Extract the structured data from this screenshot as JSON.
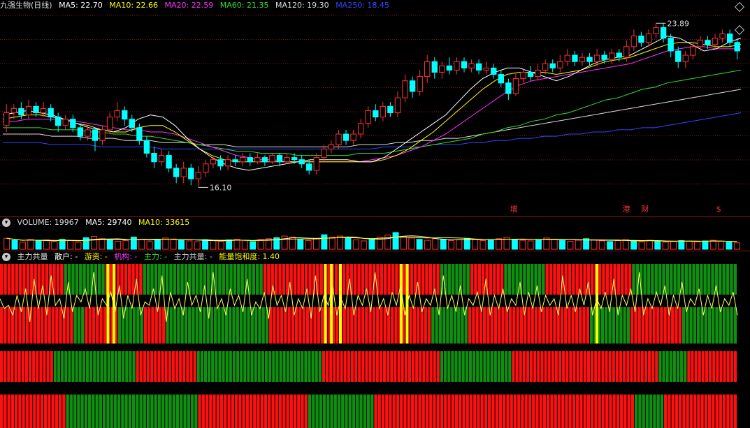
{
  "price_header": {
    "title": "九强生物(日线)",
    "ma": [
      {
        "label": "MA5: 22.70",
        "color": "#ffffff"
      },
      {
        "label": "MA10: 22.66",
        "color": "#ffff00"
      },
      {
        "label": "MA20: 22.59",
        "color": "#ff33ff"
      },
      {
        "label": "MA60: 21.35",
        "color": "#33dd33"
      },
      {
        "label": "MA120: 19.30",
        "color": "#dddddd"
      },
      {
        "label": "MA250: 18.45",
        "color": "#3344ff"
      }
    ]
  },
  "price_annotations": {
    "high": "23.89",
    "low": "16.10"
  },
  "event_marks": [
    "增",
    "港",
    "财",
    "$"
  ],
  "volume_header": {
    "title": "VOLUME: 19967",
    "ma5": "MA5: 29740",
    "ma10": "MA10: 33615"
  },
  "indicator_header": {
    "title": "主力共量",
    "items": [
      {
        "label": "散户: -",
        "color": "#ffffff"
      },
      {
        "label": "游资: -",
        "color": "#ffff00"
      },
      {
        "label": "机构: -",
        "color": "#ff33ff"
      },
      {
        "label": "主力: -",
        "color": "#33dd33"
      },
      {
        "label": "主力共量: -",
        "color": "#cccccc"
      },
      {
        "label": "能量饱和度: 1.40",
        "color": "#ffff00"
      }
    ]
  },
  "colors": {
    "up": "#ff3333",
    "down": "#00ffff",
    "bar_red": "#ff1010",
    "bar_green": "#109010",
    "highlight": "#ffff00",
    "grid": "#8a1212"
  },
  "chart_data": {
    "type": "candlestick",
    "price_axis": {
      "min": 15.2,
      "max": 24.6
    },
    "candles": [
      [
        19.3,
        19.9,
        20.3,
        19.0
      ],
      [
        19.9,
        20.1,
        20.3,
        19.6
      ],
      [
        20.1,
        19.8,
        20.4,
        19.6
      ],
      [
        19.8,
        20.2,
        20.5,
        19.6
      ],
      [
        20.2,
        19.9,
        20.4,
        19.7
      ],
      [
        19.9,
        20.1,
        20.4,
        19.7
      ],
      [
        20.1,
        19.7,
        20.3,
        19.5
      ],
      [
        19.7,
        19.3,
        19.9,
        19.0
      ],
      [
        19.3,
        19.6,
        19.8,
        19.1
      ],
      [
        19.6,
        19.2,
        19.8,
        19.0
      ],
      [
        19.2,
        18.8,
        19.4,
        18.6
      ],
      [
        18.8,
        19.1,
        19.3,
        18.6
      ],
      [
        19.1,
        18.6,
        19.2,
        18.1
      ],
      [
        18.6,
        19.1,
        19.3,
        18.4
      ],
      [
        19.1,
        19.7,
        19.9,
        18.9
      ],
      [
        19.7,
        20.0,
        20.4,
        19.5
      ],
      [
        20.0,
        19.6,
        20.2,
        19.3
      ],
      [
        19.6,
        19.2,
        19.8,
        19.0
      ],
      [
        19.2,
        18.6,
        19.4,
        18.4
      ],
      [
        18.6,
        18.0,
        18.8,
        17.8
      ],
      [
        18.0,
        17.6,
        18.3,
        17.3
      ],
      [
        17.6,
        17.9,
        18.2,
        17.4
      ],
      [
        17.9,
        17.3,
        18.1,
        17.1
      ],
      [
        17.3,
        16.9,
        17.5,
        16.6
      ],
      [
        16.9,
        17.3,
        17.6,
        16.6
      ],
      [
        17.3,
        16.8,
        17.5,
        16.5
      ],
      [
        16.8,
        17.1,
        17.4,
        16.4
      ],
      [
        17.1,
        17.5,
        17.7,
        16.9
      ],
      [
        17.5,
        17.7,
        17.9,
        17.3
      ],
      [
        17.7,
        17.4,
        17.9,
        17.2
      ],
      [
        17.4,
        17.7,
        17.9,
        17.2
      ],
      [
        17.7,
        17.6,
        17.9,
        17.4
      ],
      [
        17.6,
        17.8,
        18.0,
        17.4
      ],
      [
        17.8,
        17.6,
        18.0,
        17.4
      ],
      [
        17.6,
        17.8,
        18.0,
        17.5
      ],
      [
        17.8,
        17.6,
        17.9,
        17.4
      ],
      [
        17.6,
        17.9,
        18.0,
        17.5
      ],
      [
        17.9,
        17.6,
        18.0,
        17.4
      ],
      [
        17.6,
        17.8,
        18.0,
        17.5
      ],
      [
        17.8,
        17.7,
        18.0,
        17.5
      ],
      [
        17.7,
        17.5,
        17.9,
        17.3
      ],
      [
        17.5,
        17.2,
        17.7,
        17.0
      ],
      [
        17.2,
        17.8,
        18.0,
        17.0
      ],
      [
        17.8,
        18.2,
        18.4,
        17.6
      ],
      [
        18.2,
        18.4,
        18.6,
        18.0
      ],
      [
        18.4,
        18.9,
        19.1,
        18.2
      ],
      [
        18.9,
        18.6,
        19.1,
        18.4
      ],
      [
        18.6,
        18.9,
        19.1,
        18.4
      ],
      [
        18.9,
        19.4,
        19.6,
        18.7
      ],
      [
        19.4,
        20.0,
        20.2,
        19.2
      ],
      [
        20.0,
        19.7,
        20.3,
        19.5
      ],
      [
        19.7,
        20.2,
        20.4,
        19.5
      ],
      [
        20.2,
        19.9,
        20.4,
        19.7
      ],
      [
        19.9,
        20.6,
        20.9,
        19.7
      ],
      [
        20.6,
        21.4,
        21.7,
        20.4
      ],
      [
        21.4,
        20.9,
        21.6,
        20.6
      ],
      [
        20.9,
        21.6,
        21.9,
        20.7
      ],
      [
        21.6,
        22.3,
        22.6,
        21.3
      ],
      [
        22.3,
        21.8,
        22.5,
        21.5
      ],
      [
        21.8,
        22.1,
        22.3,
        21.5
      ],
      [
        22.1,
        21.9,
        22.5,
        21.7
      ],
      [
        21.9,
        22.3,
        22.5,
        21.7
      ],
      [
        22.3,
        22.0,
        22.5,
        21.8
      ],
      [
        22.0,
        22.2,
        22.4,
        21.8
      ],
      [
        22.2,
        21.9,
        22.4,
        21.7
      ],
      [
        21.9,
        22.0,
        22.3,
        21.7
      ],
      [
        22.0,
        21.7,
        22.2,
        21.5
      ],
      [
        21.7,
        21.3,
        21.9,
        21.1
      ],
      [
        21.3,
        20.8,
        21.5,
        20.5
      ],
      [
        20.8,
        21.5,
        21.8,
        20.7
      ],
      [
        21.5,
        21.8,
        22.0,
        21.3
      ],
      [
        21.8,
        21.6,
        22.1,
        21.4
      ],
      [
        21.6,
        21.9,
        22.2,
        21.4
      ],
      [
        21.9,
        22.2,
        22.4,
        21.7
      ],
      [
        22.2,
        22.0,
        22.4,
        21.8
      ],
      [
        22.0,
        22.3,
        22.6,
        21.8
      ],
      [
        22.3,
        22.6,
        22.9,
        22.1
      ],
      [
        22.6,
        22.3,
        22.8,
        22.1
      ],
      [
        22.3,
        22.5,
        22.7,
        22.1
      ],
      [
        22.5,
        22.3,
        22.7,
        22.1
      ],
      [
        22.3,
        22.6,
        22.9,
        22.1
      ],
      [
        22.6,
        22.4,
        22.8,
        22.2
      ],
      [
        22.4,
        22.7,
        22.9,
        22.2
      ],
      [
        22.7,
        22.5,
        22.9,
        22.3
      ],
      [
        22.5,
        23.0,
        23.3,
        22.3
      ],
      [
        23.0,
        23.5,
        23.8,
        22.8
      ],
      [
        23.5,
        23.2,
        23.7,
        23.0
      ],
      [
        23.2,
        23.6,
        23.8,
        23.0
      ],
      [
        23.6,
        23.9,
        24.1,
        23.4
      ],
      [
        23.9,
        23.4,
        24.1,
        23.2
      ],
      [
        23.4,
        22.8,
        23.6,
        22.5
      ],
      [
        22.8,
        22.3,
        23.0,
        22.0
      ],
      [
        22.3,
        22.6,
        22.8,
        22.0
      ],
      [
        22.6,
        23.0,
        23.2,
        22.4
      ],
      [
        23.0,
        23.3,
        23.5,
        22.8
      ],
      [
        23.3,
        23.1,
        23.5,
        22.9
      ],
      [
        23.1,
        23.4,
        23.6,
        22.9
      ],
      [
        23.4,
        23.6,
        23.8,
        23.2
      ],
      [
        23.6,
        23.2,
        23.8,
        23.0
      ],
      [
        23.2,
        22.8,
        23.4,
        22.4
      ]
    ],
    "ma_lines": {
      "MA5": [
        19.8,
        19.9,
        20.0,
        19.9,
        19.8,
        19.6,
        19.4,
        19.2,
        19.1,
        19.0,
        19.2,
        19.6,
        19.8,
        19.7,
        19.3,
        18.7,
        18.2,
        17.8,
        17.5,
        17.3,
        17.2,
        17.3,
        17.4,
        17.5,
        17.6,
        17.7,
        17.7,
        17.7,
        17.7,
        17.6,
        17.6,
        17.8,
        18.2,
        18.6,
        19.0,
        19.4,
        19.8,
        20.4,
        21.0,
        21.5,
        21.8,
        22.0,
        22.0,
        21.8,
        21.6,
        21.4,
        21.6,
        21.9,
        22.2,
        22.4,
        22.5,
        22.6,
        22.9,
        23.2,
        23.5,
        23.4,
        23.1,
        22.8,
        22.9,
        23.2,
        23.4
      ],
      "MA10": [
        19.6,
        19.7,
        19.8,
        19.8,
        19.7,
        19.6,
        19.4,
        19.3,
        19.1,
        19.0,
        19.0,
        19.2,
        19.3,
        19.3,
        19.0,
        18.6,
        18.2,
        17.9,
        17.7,
        17.6,
        17.6,
        17.6,
        17.6,
        17.6,
        17.6,
        17.6,
        17.6,
        17.6,
        17.6,
        17.6,
        17.6,
        17.7,
        17.9,
        18.2,
        18.6,
        19.0,
        19.5,
        20.0,
        20.5,
        21.0,
        21.4,
        21.7,
        21.8,
        21.8,
        21.8,
        21.7,
        21.8,
        21.9,
        22.1,
        22.3,
        22.4,
        22.5,
        22.7,
        22.9,
        23.1,
        23.2,
        23.2,
        23.1,
        23.0,
        23.0,
        23.1
      ],
      "MA20": [
        19.5,
        19.5,
        19.6,
        19.6,
        19.6,
        19.6,
        19.5,
        19.4,
        19.3,
        19.2,
        19.1,
        19.1,
        19.0,
        19.0,
        18.9,
        18.7,
        18.5,
        18.3,
        18.1,
        17.9,
        17.8,
        17.7,
        17.7,
        17.6,
        17.6,
        17.6,
        17.6,
        17.6,
        17.6,
        17.6,
        17.7,
        17.8,
        17.9,
        18.1,
        18.3,
        18.6,
        18.9,
        19.3,
        19.7,
        20.1,
        20.5,
        20.9,
        21.2,
        21.4,
        21.5,
        21.6,
        21.7,
        21.8,
        21.9,
        22.0,
        22.1,
        22.2,
        22.4,
        22.6,
        22.8,
        22.9,
        23.0,
        23.0,
        22.9,
        22.9,
        22.9
      ],
      "MA60": [
        19.2,
        19.2,
        19.2,
        19.2,
        19.1,
        19.1,
        19.1,
        19.0,
        19.0,
        18.9,
        18.9,
        18.8,
        18.8,
        18.7,
        18.6,
        18.5,
        18.4,
        18.3,
        18.2,
        18.1,
        18.1,
        18.0,
        18.0,
        18.0,
        17.9,
        17.9,
        17.9,
        17.9,
        17.9,
        18.0,
        18.0,
        18.0,
        18.1,
        18.2,
        18.3,
        18.4,
        18.5,
        18.6,
        18.7,
        18.9,
        19.0,
        19.2,
        19.3,
        19.5,
        19.6,
        19.8,
        19.9,
        20.1,
        20.3,
        20.5,
        20.6,
        20.8,
        21.0,
        21.1,
        21.3,
        21.4,
        21.5,
        21.6,
        21.7,
        21.8,
        21.9
      ],
      "MA120": [
        18.9,
        18.9,
        18.9,
        18.9,
        18.8,
        18.8,
        18.8,
        18.7,
        18.7,
        18.7,
        18.6,
        18.6,
        18.6,
        18.5,
        18.5,
        18.5,
        18.4,
        18.4,
        18.4,
        18.3,
        18.3,
        18.3,
        18.3,
        18.3,
        18.3,
        18.3,
        18.3,
        18.3,
        18.3,
        18.4,
        18.4,
        18.4,
        18.5,
        18.5,
        18.6,
        18.6,
        18.7,
        18.7,
        18.8,
        18.9,
        19.0,
        19.1,
        19.2,
        19.3,
        19.4,
        19.5,
        19.6,
        19.7,
        19.8,
        19.9,
        20.0,
        20.1,
        20.2,
        20.3,
        20.4,
        20.5,
        20.6,
        20.7,
        20.8,
        20.9,
        21.0
      ],
      "MA250": [
        18.5,
        18.5,
        18.5,
        18.5,
        18.4,
        18.4,
        18.4,
        18.4,
        18.3,
        18.3,
        18.3,
        18.3,
        18.3,
        18.2,
        18.2,
        18.2,
        18.2,
        18.2,
        18.2,
        18.2,
        18.2,
        18.2,
        18.2,
        18.2,
        18.2,
        18.2,
        18.2,
        18.2,
        18.2,
        18.2,
        18.2,
        18.3,
        18.3,
        18.3,
        18.3,
        18.4,
        18.4,
        18.4,
        18.5,
        18.5,
        18.6,
        18.6,
        18.7,
        18.7,
        18.8,
        18.8,
        18.9,
        18.9,
        19.0,
        19.0,
        19.1,
        19.1,
        19.2,
        19.2,
        19.3,
        19.4,
        19.5,
        19.6,
        19.7,
        19.8,
        19.9
      ]
    },
    "volume": [
      34,
      28,
      22,
      30,
      26,
      29,
      24,
      31,
      27,
      22,
      36,
      40,
      33,
      29,
      25,
      27,
      38,
      30,
      24,
      29,
      35,
      32,
      28,
      26,
      23,
      30,
      27,
      25,
      29,
      31,
      28,
      24,
      30,
      33,
      36,
      41,
      38,
      30,
      27,
      33,
      45,
      38,
      41,
      34,
      29,
      26,
      30,
      37,
      44,
      52,
      40,
      35,
      31,
      28,
      33,
      30,
      27,
      29,
      34,
      31,
      27,
      29,
      33,
      37,
      31,
      28,
      26,
      30,
      35,
      31,
      27,
      25,
      28,
      33,
      29,
      26,
      24,
      27,
      30,
      26,
      23,
      28,
      25,
      22,
      24,
      27,
      25,
      23,
      26,
      28,
      25,
      22,
      20
    ],
    "indicator_rows": [
      "RRRRRRRRRRRRRRRRRGGGGGGGGGGGRRRRRRRRRRGGGGGGGGGGGGGGGGGGGGGGGGGGGGGGGGRRRRRRRRRRRRRRRRRRRRRRRRRRRRRRRRRRRRRRRRRRRRRRRGGGGGGGGRRRRRRRRRGGGGGGGGGGGRRRRRRRRRRRRRRRRRRRRRRRGGGGGGGGGGGGGGGGGGGGGGGGGGGG",
      "RRRRRRRRRRRRRRRRRRRRGGGRRRRRRRRRGGGGGGGRRRRRRGGGGGGGGGGGGGGGGGGGGGGGGGGGGRRRRRRRRRRRRRRRRRRRRRRRRRRRRRRRRRRRRRRRRRRRRGGGGGGGGGGRRRRRRRRRRRRRRRRRRRRRRRRRRRRRRRRRGGGGGGGGGGGRRRRRRRRRRRRRRGGGGGGGGGGGGGGG",
      "RRRRRRRRRRRRRRRGGGGGGGGGGGGGGGGGGGGGGGRRRRRRRRRRRRRRRRRGGGGGGGGGGGGGGGGGGGGGGGGGGGGGGGGGGGRRRRRRRRRRRRRRRRRRRRRRRRRRRRRRRRRGGGGGGGGGGGGGGGGGGGGRRRRRRRRRRRRRRRRRRRRRRRRRRRRRRRRRRRRRRRRRGGGGGGGGRRRRRRRRRRRRRR",
      "RRRRRRRRRRRRRRRRRRGGGGGGGGGGGGGGGGGGGGGGGGGGGGGGGGGGGGRRRRRRRRRRRRRRRRRRRRRRRRRRRRRRGGGGGGGGGGGGGGGGGGRRRRRRRRRRRRRRRRRRRRRRRRRRRRRRRRRRRRRRRRRRRRRRRRRRRRRRRRRRRRRRRRRRRRRRRGGGGGGGGRRRRRRRRRRRRRRRRRRRR"
    ],
    "indicator_line": [
      55,
      40,
      45,
      30,
      60,
      35,
      70,
      20,
      85,
      40,
      75,
      30,
      90,
      45,
      55,
      25,
      80,
      35,
      60,
      50,
      70,
      40,
      95,
      30,
      55,
      45,
      65,
      35,
      75,
      25,
      60,
      40,
      85,
      30,
      50,
      45,
      70,
      35,
      90,
      20,
      65,
      40,
      55,
      30,
      80,
      45,
      60,
      35,
      75,
      25,
      95,
      40,
      55,
      30,
      70,
      45,
      60,
      35,
      85,
      30,
      50,
      40,
      65,
      25,
      75,
      45,
      60,
      35,
      80,
      30,
      55,
      40,
      70,
      25,
      90,
      35,
      60,
      45,
      75,
      30,
      55,
      40,
      85,
      30,
      60,
      45,
      70,
      35,
      95,
      40,
      55,
      30,
      65,
      45,
      75,
      30,
      60,
      40,
      80,
      35,
      55,
      45,
      70,
      30,
      90,
      40,
      60,
      35,
      75,
      30,
      55,
      45,
      65,
      35,
      85,
      30,
      60,
      40,
      70,
      35,
      55,
      45,
      80,
      30,
      65,
      40,
      75,
      35,
      60,
      45,
      55,
      30,
      90,
      40,
      60,
      35,
      70,
      45,
      80,
      30,
      55,
      40,
      65,
      35,
      85,
      30,
      60,
      45,
      70,
      35,
      95,
      30,
      55,
      40,
      65,
      45,
      75,
      30,
      60,
      40,
      80,
      35,
      55,
      45,
      70,
      30,
      60,
      40,
      75,
      35,
      55,
      45,
      65,
      30
    ],
    "indicator_highlight_positions": [
      0.142,
      0.15,
      0.432,
      0.44,
      0.452,
      0.533,
      0.541,
      0.794
    ]
  }
}
